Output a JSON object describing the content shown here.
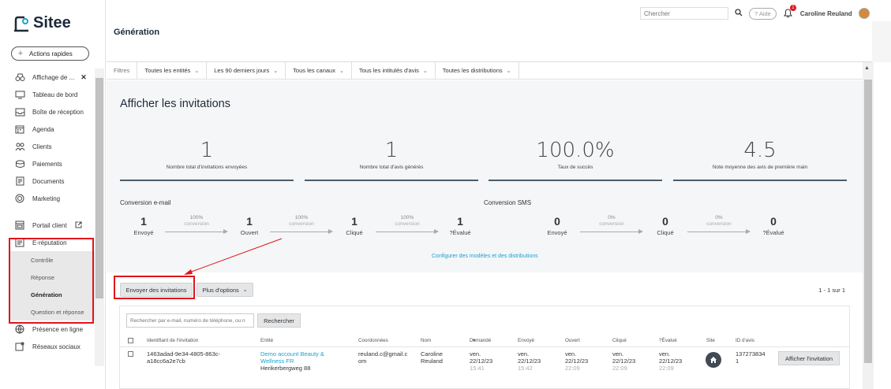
{
  "app": {
    "brand": "Sitee"
  },
  "sidebar": {
    "quick_actions": "Actions rapides",
    "items": [
      {
        "label": "Affichage de ...",
        "icon": "binoculars-icon"
      },
      {
        "label": "Tableau de bord",
        "icon": "dashboard-icon"
      },
      {
        "label": "Boîte de réception",
        "icon": "inbox-icon"
      },
      {
        "label": "Agenda",
        "icon": "calendar-icon"
      },
      {
        "label": "Clients",
        "icon": "users-icon"
      },
      {
        "label": "Paiements",
        "icon": "payments-icon"
      },
      {
        "label": "Documents",
        "icon": "document-icon"
      },
      {
        "label": "Marketing",
        "icon": "marketing-icon"
      }
    ],
    "portal": "Portail client",
    "ereputation": "E-réputation",
    "sub_items": [
      "Contrôle",
      "Réponse",
      "Génération",
      "Question et réponse"
    ],
    "presence": "Présence en ligne",
    "social": "Réseaux sociaux"
  },
  "topbar": {
    "search_placeholder": "Chercher",
    "help": "Aide",
    "notif_count": "1",
    "user": "Caroline Reuland"
  },
  "header": {
    "title": "Génération"
  },
  "filters": {
    "label": "Filtres",
    "items": [
      "Toutes les entités",
      "Les 90 derniers jours",
      "Tous les canaux",
      "Tous les intitulés d'avis",
      "Toutes les distributions"
    ]
  },
  "main": {
    "title": "Afficher les invitations",
    "stats": [
      {
        "value": "1",
        "label": "Nombre total d'invitations envoyées"
      },
      {
        "value": "1",
        "label": "Nombre total d'avis générés"
      },
      {
        "value": "100.0%",
        "label": "Taux de succès"
      },
      {
        "value": "4.5",
        "label": "Note moyenne des avis de première main"
      }
    ],
    "email_conv": {
      "title": "Conversion e-mail",
      "steps": [
        {
          "n": "1",
          "l": "Envoyé"
        },
        {
          "n": "1",
          "l": "Ouvert"
        },
        {
          "n": "1",
          "l": "Cliqué"
        },
        {
          "n": "1",
          "l": "?Évalué"
        }
      ],
      "rates": [
        "100%",
        "100%",
        "100%"
      ],
      "conversion_label": "conversion"
    },
    "sms_conv": {
      "title": "Conversion SMS",
      "steps": [
        {
          "n": "0",
          "l": "Envoyé"
        },
        {
          "n": "0",
          "l": "Cliqué"
        },
        {
          "n": "0",
          "l": "?Évalué"
        }
      ],
      "rates": [
        "0%",
        "0%"
      ],
      "conversion_label": "conversion"
    },
    "config_link": "Configurer des modèles et des distributions",
    "send_button": "Envoyer des invitations",
    "more_options": "Plus d'options",
    "pager": "1 - 1 sur 1",
    "search_placeholder": "Rechercher par e-mail, numéro de téléphone, ou n",
    "search_button": "Rechercher",
    "columns": [
      "Identifiant de l'invitation",
      "Entité",
      "Coordonnées",
      "Nom",
      "Demandé",
      "Envoyé",
      "Ouvert",
      "Cliqué",
      "?Évalué",
      "Site",
      "ID d'avis"
    ],
    "row": {
      "id_line1": "1463adad-9e34-4805-863c-",
      "id_line2": "a18cc6a2e7cb",
      "entity_line1": "Demo account Beauty &",
      "entity_line2": "Wellness FR",
      "entity_line3": "Herikerbergweg 88",
      "contact_line1": "reuland.c@gmail.c",
      "contact_line2": "om",
      "name_line1": "Caroline",
      "name_line2": "Reuland",
      "requested": [
        "ven.",
        "22/12/23",
        "15:41"
      ],
      "sent": [
        "ven.",
        "22/12/23",
        "15:42"
      ],
      "opened": [
        "ven.",
        "22/12/23",
        "22:09"
      ],
      "clicked": [
        "ven.",
        "22/12/23",
        "22:09"
      ],
      "evaluated": [
        "ven.",
        "22/12/23",
        "22:09"
      ],
      "review_id_line1": "137273834",
      "review_id_line2": "1",
      "action": "Afficher l'invitation"
    }
  },
  "colors": {
    "accent": "#1aa3cf",
    "highlight": "#e0141b",
    "dark": "#1d2a3a"
  }
}
